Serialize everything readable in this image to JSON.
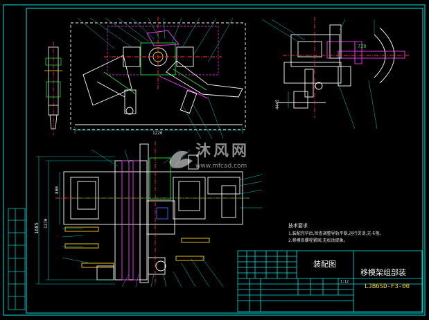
{
  "drawing": {
    "tech_req_title": "技术要求",
    "tech_req_lines": [
      "1.装配完毕后,检查调整导轨平稳,运行灵活,无卡阻。",
      "2.移模各螺栓紧固,无松动现象。"
    ],
    "title_block": {
      "view_name": "装配图",
      "part_name": "移模架组部装",
      "drawing_no": "LJB6SD-F3-00",
      "scale": "1:12"
    },
    "dimensions": [
      "1220",
      "800",
      "1370",
      "1685",
      "720",
      "4445"
    ],
    "watermark": {
      "brand": "沐风网",
      "url": "www.mfcad.com"
    },
    "colors": {
      "background": "#000000",
      "outline": "#ffffff",
      "frame": "#00e5e5",
      "leader": "#00c8c8",
      "accent_green": "#27d83f",
      "accent_magenta": "#ff38ff",
      "accent_yellow": "#ffd21c",
      "accent_red": "#ff2d2d",
      "accent_blue": "#3a6cff"
    }
  }
}
